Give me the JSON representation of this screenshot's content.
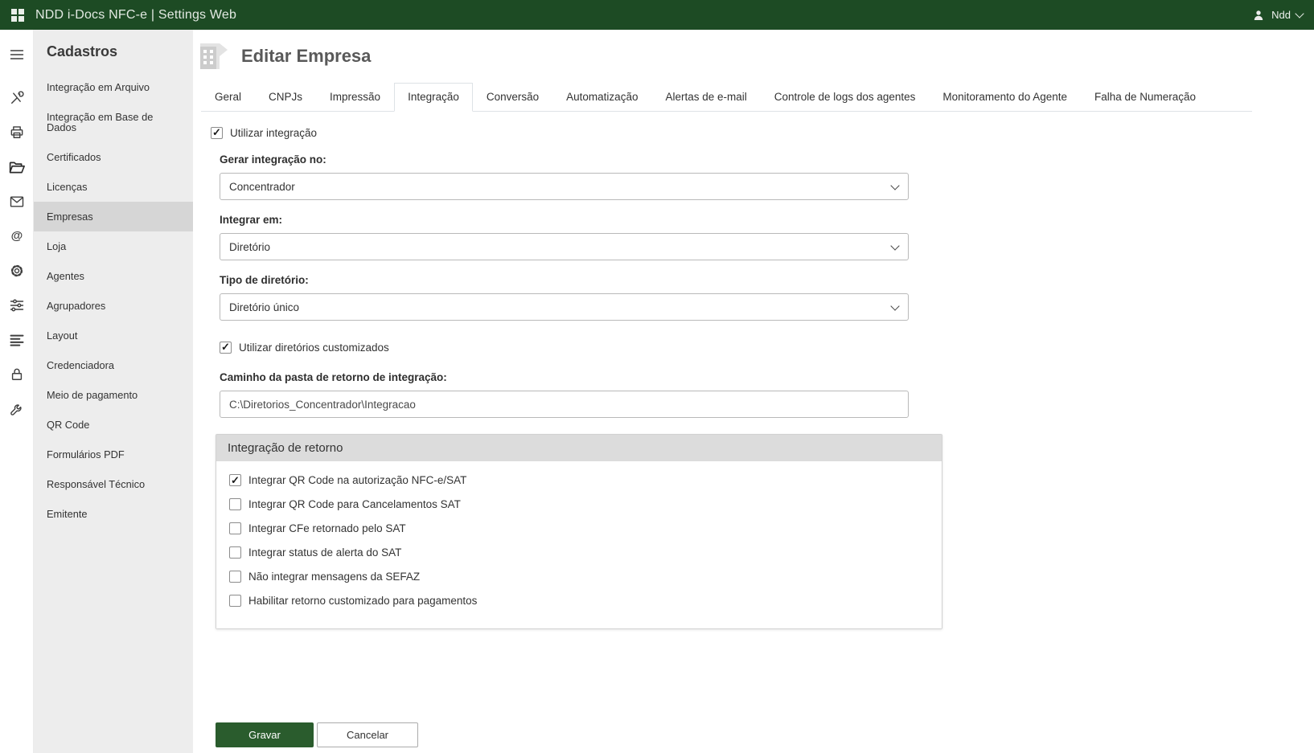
{
  "topbar": {
    "title": "NDD i-Docs NFC-e | Settings Web",
    "user_label": "Ndd"
  },
  "sidebar": {
    "title": "Cadastros",
    "items": [
      {
        "label": "Integração em Arquivo"
      },
      {
        "label": "Integração em Base de Dados"
      },
      {
        "label": "Certificados"
      },
      {
        "label": "Licenças"
      },
      {
        "label": "Empresas",
        "active": true
      },
      {
        "label": "Loja"
      },
      {
        "label": "Agentes"
      },
      {
        "label": "Agrupadores"
      },
      {
        "label": "Layout"
      },
      {
        "label": "Credenciadora"
      },
      {
        "label": "Meio de pagamento"
      },
      {
        "label": "QR Code"
      },
      {
        "label": "Formulários PDF"
      },
      {
        "label": "Responsável Técnico"
      },
      {
        "label": "Emitente"
      }
    ]
  },
  "page": {
    "title": "Editar Empresa"
  },
  "tabs": [
    {
      "label": "Geral"
    },
    {
      "label": "CNPJs"
    },
    {
      "label": "Impressão"
    },
    {
      "label": "Integração",
      "active": true
    },
    {
      "label": "Conversão"
    },
    {
      "label": "Automatização"
    },
    {
      "label": "Alertas de e-mail"
    },
    {
      "label": "Controle de logs dos agentes"
    },
    {
      "label": "Monitoramento do Agente"
    },
    {
      "label": "Falha de Numeração"
    }
  ],
  "form": {
    "use_integration": {
      "label": "Utilizar integração",
      "checked": true
    },
    "generate_in": {
      "label": "Gerar integração no:",
      "value": "Concentrador"
    },
    "integrate_in": {
      "label": "Integrar em:",
      "value": "Diretório"
    },
    "dir_type": {
      "label": "Tipo de diretório:",
      "value": "Diretório único"
    },
    "custom_dirs": {
      "label": "Utilizar diretórios customizados",
      "checked": true
    },
    "return_path": {
      "label": "Caminho da pasta de retorno de integração:",
      "value": "C:\\Diretorios_Concentrador\\Integracao"
    },
    "return_panel": {
      "title": "Integração de retorno",
      "options": [
        {
          "label": "Integrar QR Code na autorização NFC-e/SAT",
          "checked": true
        },
        {
          "label": "Integrar QR Code para Cancelamentos SAT",
          "checked": false
        },
        {
          "label": "Integrar CFe retornado pelo SAT",
          "checked": false
        },
        {
          "label": "Integrar status de alerta do SAT",
          "checked": false
        },
        {
          "label": "Não integrar mensagens da SEFAZ",
          "checked": false
        },
        {
          "label": "Habilitar retorno customizado para pagamentos",
          "checked": false
        }
      ]
    }
  },
  "actions": {
    "save": "Gravar",
    "cancel": "Cancelar"
  },
  "colors": {
    "brand_green": "#1d4b24",
    "button_green": "#2a5c2d",
    "sidebar_bg": "#ededed",
    "active_item_bg": "#d6d6d6"
  }
}
